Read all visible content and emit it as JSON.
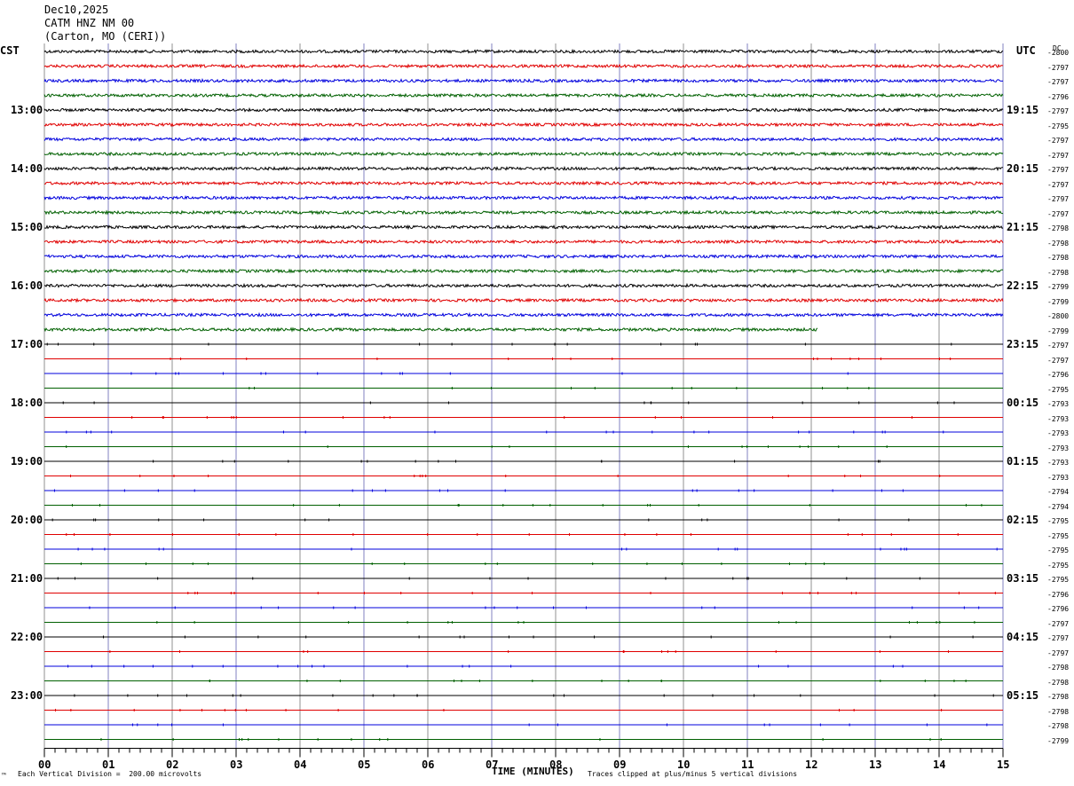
{
  "header": {
    "date": "Dec10,2025",
    "station": "CATM HNZ NM 00",
    "location": "(Carton, MO (CERI))"
  },
  "left_zone": "CST",
  "right_zone": "UTC",
  "dc_label": "DC",
  "footer": {
    "left": "Each Vertical Division =  200.00 microvolts",
    "right": "Traces clipped at plus/minus 5 vertical divisions",
    "corner": "™"
  },
  "colors": {
    "black": "#000000",
    "red": "#e00000",
    "blue": "#0000dd",
    "green": "#006000",
    "grid": "#808080"
  },
  "chart_data": {
    "type": "line",
    "title": "CATM HNZ NM 00",
    "xlabel": "TIME (MINUTES)",
    "x_ticks": [
      "00",
      "01",
      "02",
      "03",
      "04",
      "05",
      "06",
      "07",
      "08",
      "09",
      "10",
      "11",
      "12",
      "13",
      "14",
      "15"
    ],
    "xlim": [
      0,
      15
    ],
    "trace_colors": [
      "black",
      "red",
      "blue",
      "green"
    ],
    "left_hour_labels": [
      "13:00",
      "14:00",
      "15:00",
      "16:00",
      "17:00",
      "18:00",
      "19:00",
      "20:00",
      "21:00",
      "22:00",
      "23:00"
    ],
    "right_hour_labels": [
      "19:15",
      "20:15",
      "21:15",
      "22:15",
      "23:15",
      "00:15",
      "01:15",
      "02:15",
      "03:15",
      "04:15",
      "05:15"
    ],
    "dc_offsets": [
      "2800",
      "2797",
      "2797",
      "2796",
      "2797",
      "2795",
      "2797",
      "2797",
      "2797",
      "2797",
      "2797",
      "2797",
      "2798",
      "2798",
      "2798",
      "2798",
      "2799",
      "2799",
      "2800",
      "2799",
      "2797",
      "2797",
      "2796",
      "2795",
      "2793",
      "2793",
      "2793",
      "2793",
      "2793",
      "2793",
      "2794",
      "2794",
      "2795",
      "2795",
      "2795",
      "2795",
      "2795",
      "2796",
      "2796",
      "2797",
      "2797",
      "2797",
      "2798",
      "2798",
      "2798",
      "2798",
      "2798",
      "2799"
    ],
    "active_trace_count": 20,
    "active_last_trace_end_minute": 12.1
  }
}
